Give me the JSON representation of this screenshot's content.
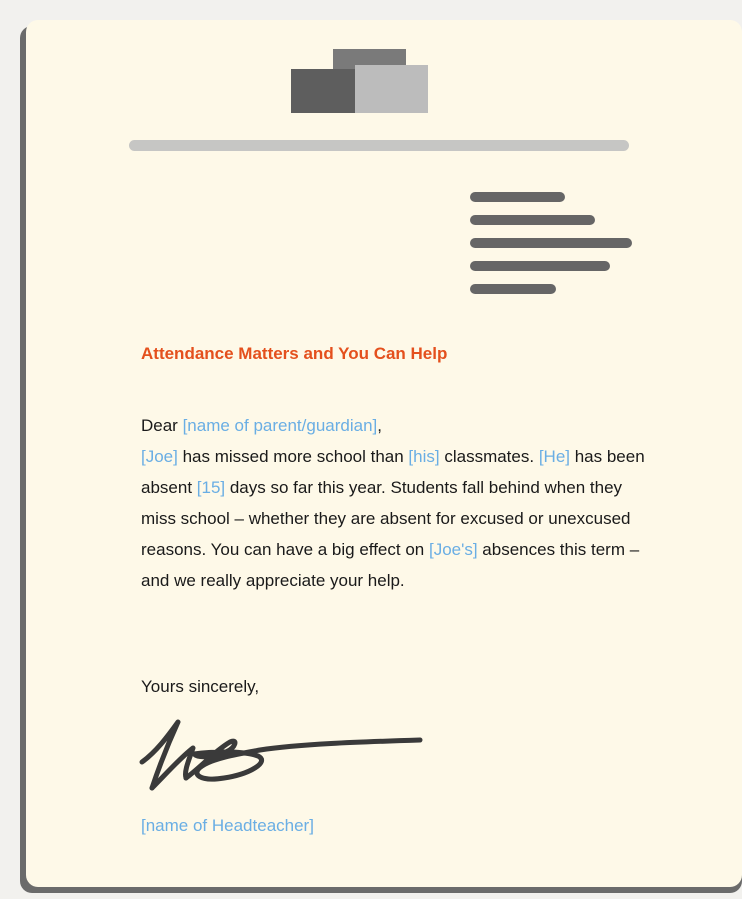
{
  "colors": {
    "page_background": "#fef9e8",
    "heading": "#e4501d",
    "placeholder": "#6aaee4",
    "text": "#1a1a1a"
  },
  "logo": {
    "icon": "school-logo-icon"
  },
  "title": "Attendance Matters and You Can Help",
  "salutation": {
    "prefix": "Dear ",
    "recipient": "[name of parent/guardian]",
    "suffix": ","
  },
  "body": {
    "child_name": "[Joe]",
    "t1": " has missed more school than ",
    "pronoun_possessive": "[his]",
    "t2": " classmates. ",
    "pronoun_subject": "[He]",
    "t3": " has been absent ",
    "days": "[15]",
    "t4": " days so far this year. Students fall behind when they miss school – whether they are absent for excused or unexcused reasons. You can have a big effect on ",
    "child_possessive": "[Joe's]",
    "t5": " absences this term – and we really appreciate your help."
  },
  "closing": "Yours sincerely,",
  "signature": {
    "icon": "signature-icon"
  },
  "headteacher": "[name of Headteacher]"
}
